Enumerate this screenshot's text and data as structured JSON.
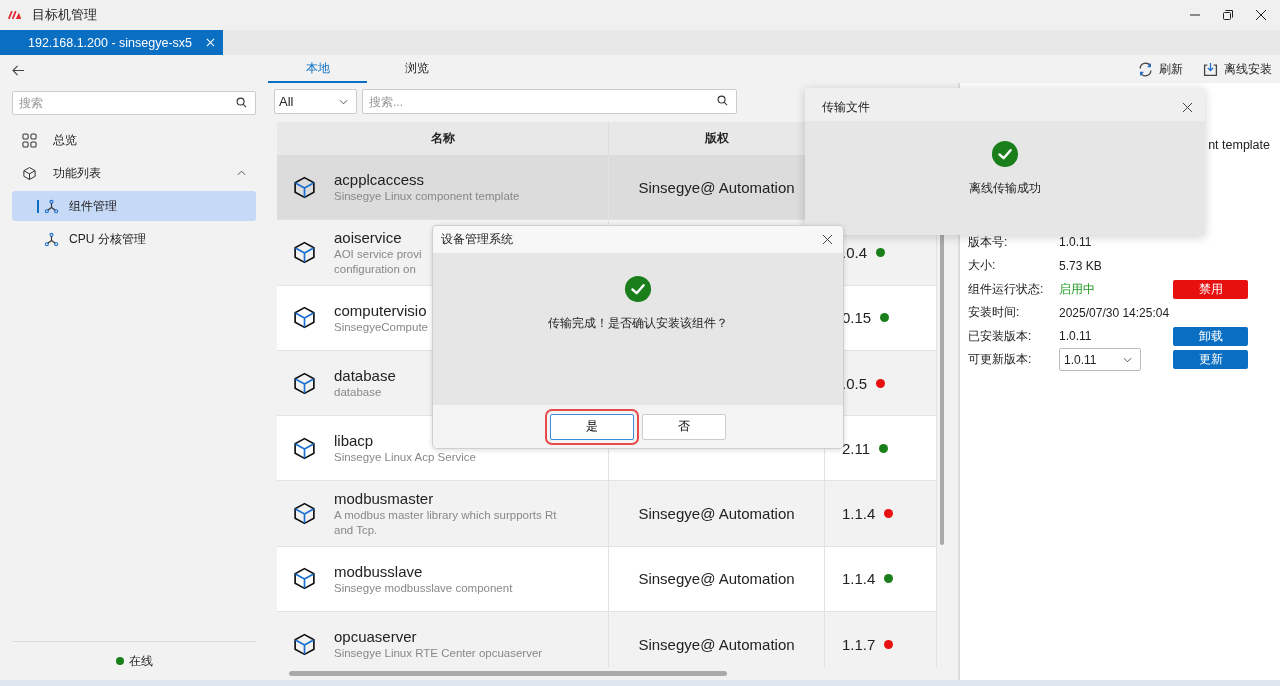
{
  "window": {
    "title": "目标机管理"
  },
  "connection_tabs": [
    {
      "label": "192.168.1.200 - sinsegye-sx5",
      "selected": true
    }
  ],
  "sidebar": {
    "search": {
      "placeholder": "搜索"
    },
    "items": [
      {
        "kind": "link",
        "label": "总览",
        "selected": false
      },
      {
        "kind": "group",
        "label": "功能列表",
        "expanded": true,
        "children": [
          {
            "label": "组件管理",
            "selected": true
          },
          {
            "label": "CPU 分核管理",
            "selected": false
          }
        ]
      }
    ],
    "status": {
      "label": "在线",
      "online": true
    }
  },
  "view_tabs": [
    {
      "label": "本地",
      "selected": true
    },
    {
      "label": "浏览",
      "selected": false
    }
  ],
  "toolbar": [
    {
      "kind": "refresh",
      "label": "刷新"
    },
    {
      "kind": "install",
      "label": "离线安装"
    }
  ],
  "filter": {
    "value": "All"
  },
  "search": {
    "placeholder": "搜索..."
  },
  "table": {
    "columns": [
      "名称",
      "版权"
    ],
    "rows": [
      {
        "name": "acpplcaccess",
        "description": [
          "Sinsegye Linux component template"
        ],
        "copyright": "Sinsegye@ Automation",
        "selected": true
      },
      {
        "name": "aoiservice",
        "description": [
          "AOI service provi",
          "configuration on"
        ],
        "version": ".0.4",
        "color": "#1a7f1a",
        "selected": false
      },
      {
        "name": "computervisio",
        "description": [
          "SinsegyeCompute"
        ],
        "version": "0.15",
        "color": "#1a7f1a",
        "selected": false
      },
      {
        "name": "database",
        "description": [
          "database"
        ],
        "version": ".0.5",
        "color": "#e81010",
        "selected": false
      },
      {
        "name": "libacp",
        "description": [
          "Sinsegye Linux Acp Service"
        ],
        "version": "2.11",
        "color": "#1a7f1a",
        "selected": false
      },
      {
        "name": "modbusmaster",
        "description": [
          "A modbus master library which surpports Rt",
          "and Tcp."
        ],
        "copyright": "Sinsegye@ Automation",
        "version": "1.1.4",
        "color": "#e81010",
        "selected": false
      },
      {
        "name": "modbusslave",
        "description": [
          "Sinsegye modbusslave component"
        ],
        "copyright": "Sinsegye@ Automation",
        "version": "1.1.4",
        "color": "#1a7f1a",
        "selected": false
      },
      {
        "name": "opcuaserver",
        "description": [
          "Sinsegye Linux RTE Center opcuaserver"
        ],
        "copyright": "Sinsegye@ Automation",
        "version": "1.1.7",
        "color": "#e81010",
        "selected": false
      }
    ]
  },
  "detail": {
    "description_fragment": "nt template",
    "fields": [
      {
        "kind": "text",
        "label": "版本号:",
        "value": "1.0.11"
      },
      {
        "kind": "text",
        "label": "大小:",
        "value": "5.73 KB"
      },
      {
        "kind": "status",
        "label": "组件运行状态:",
        "value": "启用中",
        "action": {
          "label": "禁用",
          "kind": "danger"
        }
      },
      {
        "kind": "text",
        "label": "安装时间:",
        "value": "2025/07/30 14:25:04"
      },
      {
        "kind": "text",
        "label": "已安装版本:",
        "value": "1.0.11",
        "action": {
          "label": "卸载",
          "kind": "primary"
        }
      },
      {
        "kind": "select",
        "label": "可更新版本:",
        "value": "1.0.11",
        "action": {
          "label": "更新",
          "kind": "primary"
        }
      }
    ]
  },
  "transfer_panel": {
    "title": "传输文件",
    "message": "离线传输成功"
  },
  "dialog": {
    "title": "设备管理系统",
    "message": "传输完成！是否确认安装该组件？",
    "buttons": [
      {
        "label": "是",
        "selected": true
      },
      {
        "label": "否",
        "selected": false
      }
    ]
  }
}
